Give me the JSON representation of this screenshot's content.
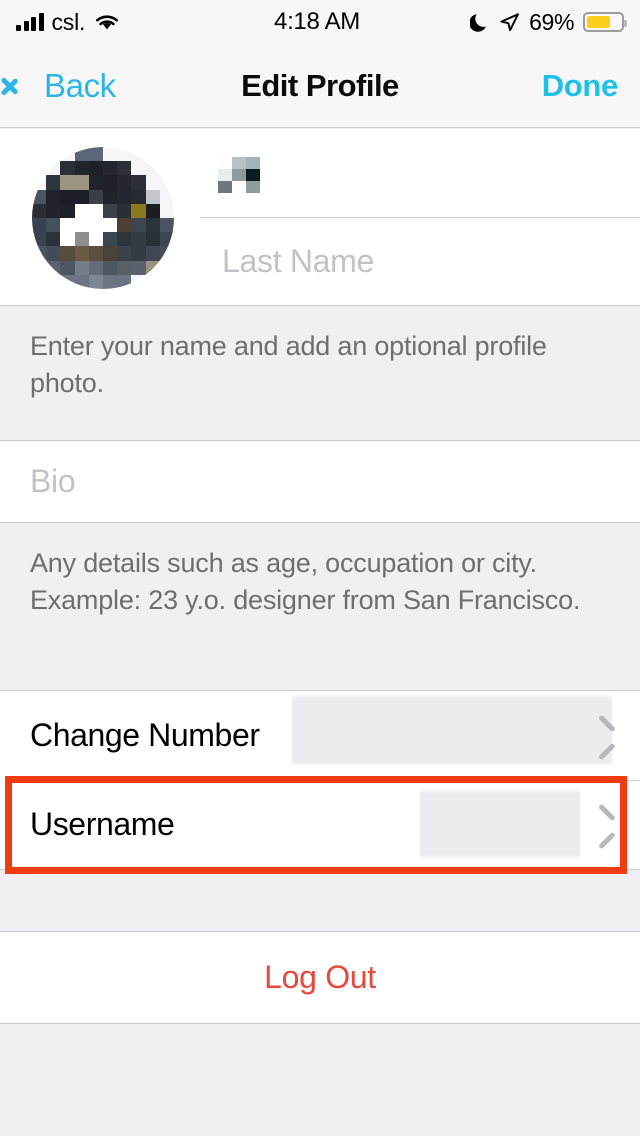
{
  "status_bar": {
    "carrier": "csl.",
    "time": "4:18 AM",
    "battery_percent": "69%",
    "battery_level": 69,
    "battery_color": "#FCCF1D",
    "signal_bars": 4,
    "icons": [
      "cellular-signal-icon",
      "wifi-icon",
      "moon-icon",
      "location-arrow-icon",
      "battery-icon"
    ]
  },
  "nav_bar": {
    "back_label": "Back",
    "title": "Edit Profile",
    "done_label": "Done",
    "tint_color": "#2EB5E8"
  },
  "profile": {
    "avatar_state": "pixelated-redacted-photo",
    "first_name_value": "",
    "first_name_state": "pixelated-redacted",
    "last_name_placeholder": "Last Name",
    "name_note": "Enter your name and add an optional profile photo.",
    "bio_placeholder": "Bio",
    "bio_note": "Any details such as age, occupation or city. Example: 23 y.o. designer from San Francisco."
  },
  "settings_list": {
    "rows": [
      {
        "label": "Change Number",
        "value": "",
        "value_state": "blurred-redacted",
        "accessory": "chevron-right-icon"
      },
      {
        "label": "Username",
        "value": "",
        "value_state": "blurred-redacted",
        "accessory": "chevron-right-icon"
      }
    ]
  },
  "logout": {
    "label": "Log Out",
    "color": "#E8483A"
  },
  "annotation": {
    "target": "Username",
    "color": "#F03C10",
    "shape": "rectangle-outline"
  },
  "colors": {
    "section_background": "#EFEFF4",
    "row_background": "#FFFFFF",
    "separator": "#C9C9CE",
    "placeholder_text": "#C2C2C7",
    "note_text": "#6D6D72",
    "nav_background": "#F7F7F7"
  },
  "avatar_mosaic": [
    "#f6f6f8",
    "#f6f6f8",
    "#f6f6f8",
    "#5b6775",
    "#5b6775",
    "#f6f6f8",
    "#f6f6f8",
    "#f6f6f8",
    "#f6f6f8",
    "#f6f6f8",
    "#f6f6f8",
    "#f6f6f8",
    "#2b2f36",
    "#22262c",
    "#1e2228",
    "#24282e",
    "#2b2f36",
    "#f6f6f8",
    "#f6f6f8",
    "#f6f6f8",
    "#f6f6f8",
    "#2f333a",
    "#9c9483",
    "#9c9483",
    "#1f232a",
    "#1e2228",
    "#24282e",
    "#2b2f36",
    "#f6f6f8",
    "#f6f6f8",
    "#4a5560",
    "#1f232a",
    "#1c2026",
    "#1c2026",
    "#3a3f46",
    "#1f232a",
    "#222730",
    "#262a31",
    "#c3c6cb",
    "#f6f6f8",
    "#2a2e35",
    "#20242a",
    "#1e2228",
    "#ffffff",
    "#ffffff",
    "#3d424a",
    "#2a2e35",
    "#8a7a1e",
    "#1a1d22",
    "#f6f6f8",
    "#39424e",
    "#46505c",
    "#ffffff",
    "#ffffff",
    "#ffffff",
    "#ffffff",
    "#4a4038",
    "#3b444f",
    "#2c323a",
    "#4b545f",
    "#3a434f",
    "#2c323a",
    "#ffffff",
    "#8d8e90",
    "#ffffff",
    "#3c4550",
    "#2f353d",
    "#343b44",
    "#2a3038",
    "#3c444f",
    "#4a545f",
    "#434c57",
    "#574d3f",
    "#6b5a43",
    "#5a4f41",
    "#4a4238",
    "#3a4149",
    "#343b44",
    "#3f4852",
    "#464f59",
    "#59626d",
    "#59626d",
    "#4d5661",
    "#747e88",
    "#636c77",
    "#4e5761",
    "#596069",
    "#58616c",
    "#98927f",
    "#f6f6f8",
    "#f6f6f8",
    "#eaeaec",
    "#6b7480",
    "#6b7480",
    "#7e8791",
    "#6b7480",
    "#6b7480",
    "#f6f6f8",
    "#f6f6f8",
    "#f6f6f8"
  ],
  "redacted_first_mosaic": [
    "#fdfdfd",
    "#b4c3c8",
    "#a2b4b9",
    "#e9eced",
    "#8e9a9c",
    "#0d1a1f",
    "#6f777a",
    "#fdfdfd",
    "#8f9b9d",
    "#92a0a2"
  ]
}
